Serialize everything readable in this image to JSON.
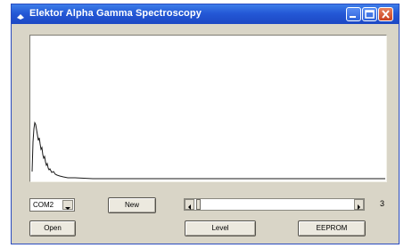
{
  "window": {
    "title": "Elektor Alpha Gamma Spectroscopy"
  },
  "port": {
    "selected": "COM2"
  },
  "buttons": {
    "new": "New",
    "open": "Open",
    "level": "Level",
    "eeprom": "EEPROM"
  },
  "scrollbar": {
    "position_label": "3"
  },
  "colors": {
    "titlebar": "#2458d6",
    "trace": "#1a1a1a"
  },
  "icons": [
    "app-icon",
    "minimize-icon",
    "maximize-icon",
    "close-icon",
    "chevron-down-icon",
    "arrow-left-icon",
    "arrow-right-icon"
  ]
}
